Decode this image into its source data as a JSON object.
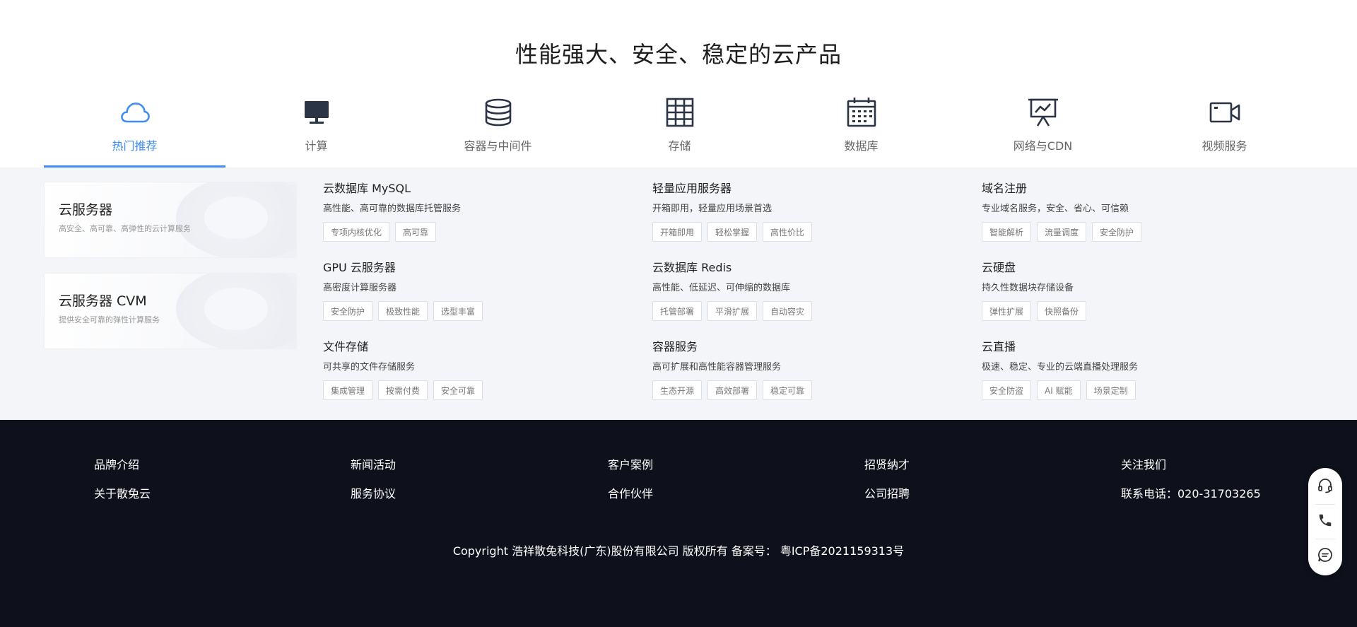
{
  "page_title": "性能强大、安全、稳定的云产品",
  "tabs": [
    {
      "label": "热门推荐",
      "icon": "cloud-icon",
      "active": true
    },
    {
      "label": "计算",
      "icon": "monitor-icon"
    },
    {
      "label": "容器与中间件",
      "icon": "database-icon"
    },
    {
      "label": "存储",
      "icon": "grid-storage-icon"
    },
    {
      "label": "数据库",
      "icon": "calendar-icon"
    },
    {
      "label": "网络与CDN",
      "icon": "presentation-chart-icon"
    },
    {
      "label": "视频服务",
      "icon": "video-camera-icon"
    }
  ],
  "feature_cards": [
    {
      "title": "云服务器",
      "desc": "高安全、高可靠、高弹性的云计算服务"
    },
    {
      "title": "云服务器 CVM",
      "desc": "提供安全可靠的弹性计算服务"
    }
  ],
  "products": [
    {
      "name": "云数据库 MySQL",
      "desc": "高性能、高可靠的数据库托管服务",
      "tags": [
        "专项内核优化",
        "高可靠"
      ]
    },
    {
      "name": "轻量应用服务器",
      "desc": "开箱即用，轻量应用场景首选",
      "tags": [
        "开箱即用",
        "轻松掌握",
        "高性价比"
      ]
    },
    {
      "name": "域名注册",
      "desc": "专业域名服务，安全、省心、可信赖",
      "tags": [
        "智能解析",
        "流量调度",
        "安全防护"
      ]
    },
    {
      "name": "GPU 云服务器",
      "desc": "高密度计算服务器",
      "tags": [
        "安全防护",
        "极致性能",
        "选型丰富"
      ]
    },
    {
      "name": "云数据库 Redis",
      "desc": "高性能、低延迟、可伸缩的数据库",
      "tags": [
        "托管部署",
        "平滑扩展",
        "自动容灾"
      ]
    },
    {
      "name": "云硬盘",
      "desc": "持久性数据块存储设备",
      "tags": [
        "弹性扩展",
        "快照备份"
      ]
    },
    {
      "name": "文件存储",
      "desc": "可共享的文件存储服务",
      "tags": [
        "集成管理",
        "按需付费",
        "安全可靠"
      ]
    },
    {
      "name": "容器服务",
      "desc": "高可扩展和高性能容器管理服务",
      "tags": [
        "生态开源",
        "高效部署",
        "稳定可靠"
      ]
    },
    {
      "name": "云直播",
      "desc": "极速、稳定、专业的云端直播处理服务",
      "tags": [
        "安全防盗",
        "AI 赋能",
        "场景定制"
      ]
    }
  ],
  "footer": {
    "columns": [
      {
        "top": "品牌介绍",
        "bottom": "关于散兔云"
      },
      {
        "top": "新闻活动",
        "bottom": "服务协议"
      },
      {
        "top": "客户案例",
        "bottom": "合作伙伴"
      },
      {
        "top": "招贤纳才",
        "bottom": "公司招聘"
      },
      {
        "top": "关注我们",
        "bottom": "联系电话：020-31703265"
      }
    ],
    "copyright": "Copyright 浩祥散兔科技(广东)股份有限公司 版权所有 备案号：  粤ICP备2021159313号"
  },
  "side_widget": {
    "icons": [
      "headset-icon",
      "phone-icon",
      "chat-icon"
    ]
  },
  "colors": {
    "accent": "#3d8df5",
    "footer_bg": "#0e101b",
    "products_bg": "#f4f5f9",
    "icon_dark": "#2b3445"
  }
}
